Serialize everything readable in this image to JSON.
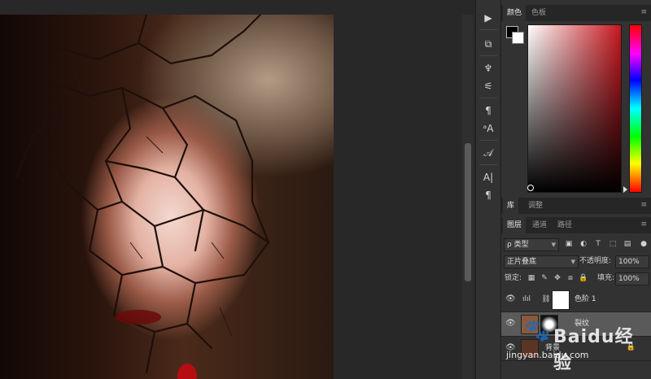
{
  "watermark": {
    "brand": "Baidu经验",
    "url": "jingyan.baidu.com"
  },
  "dock": {
    "tools": [
      {
        "name": "play-icon",
        "glyph": "▶"
      },
      {
        "name": "brush-preset-icon",
        "glyph": "⧉"
      },
      {
        "name": "brush-settings-icon",
        "glyph": "♆"
      },
      {
        "name": "adjust-sliders-icon",
        "glyph": "⚟"
      },
      {
        "name": "paragraph-style-icon",
        "glyph": "¶"
      },
      {
        "name": "character-style-icon",
        "glyph": "ᵃA"
      },
      {
        "name": "glyphs-icon",
        "glyph": "𝒜"
      },
      {
        "name": "character-icon",
        "glyph": "A|"
      },
      {
        "name": "paragraph-icon",
        "glyph": "¶"
      }
    ],
    "collapse_glyph": "«"
  },
  "color_panel": {
    "tabs": [
      "颜色",
      "色板"
    ],
    "foreground": "#000000",
    "background": "#ffffff",
    "hue": "#c8171e",
    "menu_glyph": "≡"
  },
  "library_panel": {
    "tabs": [
      "库",
      "调整"
    ],
    "menu_glyph": "≡"
  },
  "layers_panel": {
    "tabs": [
      "图层",
      "通道",
      "路径"
    ],
    "menu_glyph": "≡",
    "filter": {
      "search_glyph": "ρ",
      "value": "类型"
    },
    "filter_icons": [
      "image-filter-icon",
      "adjustment-filter-icon",
      "type-filter-icon",
      "shape-filter-icon",
      "smart-object-filter-icon"
    ],
    "blend_mode": "正片叠底",
    "opacity_label": "不透明度:",
    "opacity_value": "100%",
    "lock_label": "锁定:",
    "fill_label": "填充:",
    "fill_value": "100%",
    "layers": [
      {
        "name": "色阶 1",
        "selected": false
      },
      {
        "name": "裂纹",
        "selected": true
      },
      {
        "name": "背景",
        "selected": false
      }
    ]
  }
}
